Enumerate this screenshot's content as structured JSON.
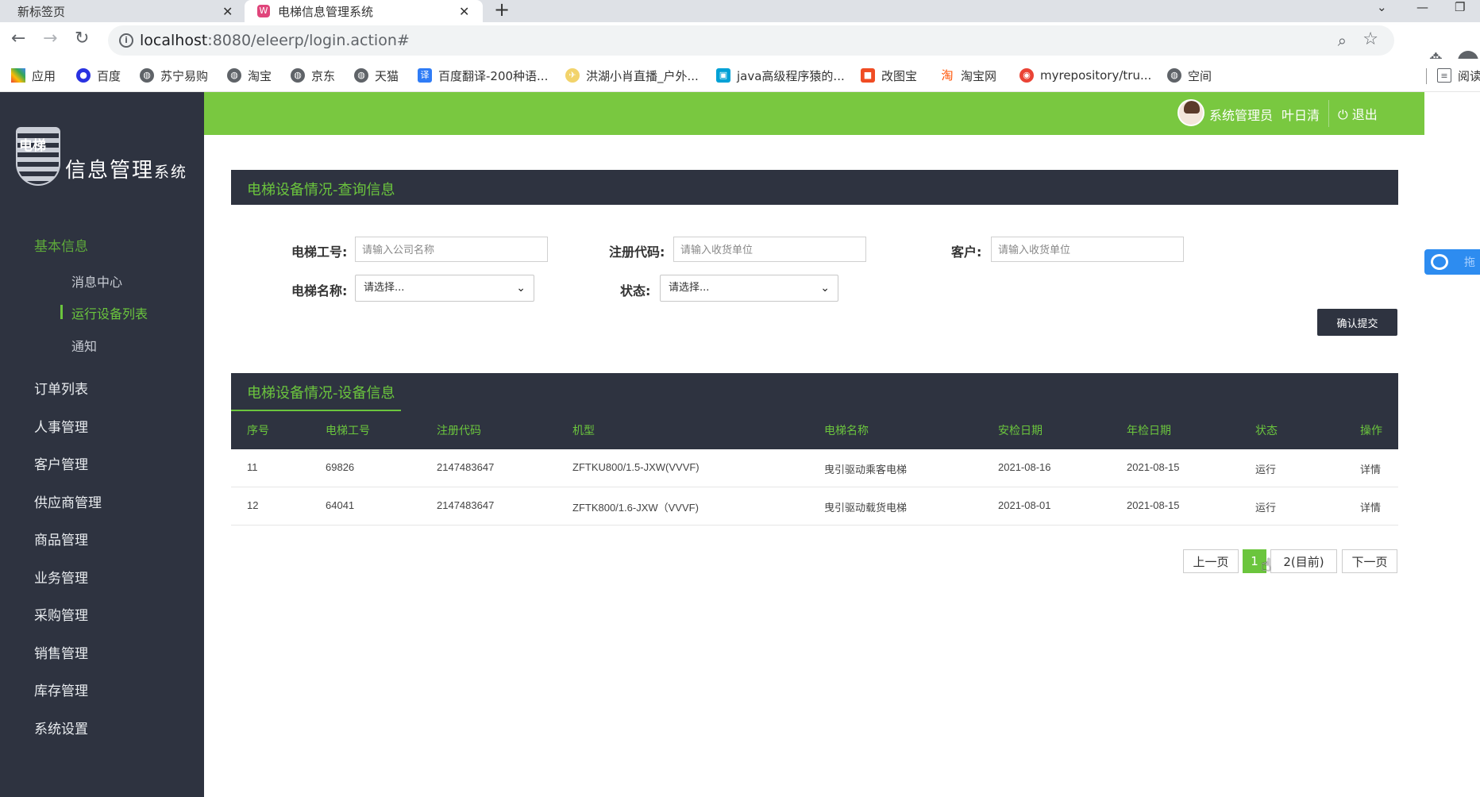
{
  "browser": {
    "tabs": [
      {
        "title": "新标签页",
        "active": false
      },
      {
        "title": "电梯信息管理系统",
        "active": true
      }
    ],
    "url_host": "localhost",
    "url_path": ":8080/eleerp/login.action#",
    "bookmarks": [
      "应用",
      "百度",
      "苏宁易购",
      "淘宝",
      "京东",
      "天猫",
      "百度翻译-200种语...",
      "洪湖小肖直播_户外...",
      "java高级程序猿的...",
      "改图宝",
      "淘宝网",
      "myrepository/tru...",
      "空间"
    ],
    "reading_list": "阅读"
  },
  "logo": {
    "shield_text": "电梯",
    "title": "信息管理",
    "title_small": "系统"
  },
  "sidebar": {
    "groups": [
      {
        "label": "基本信息",
        "active": true
      },
      {
        "label": "订单列表"
      },
      {
        "label": "人事管理"
      },
      {
        "label": "客户管理"
      },
      {
        "label": "供应商管理"
      },
      {
        "label": "商品管理"
      },
      {
        "label": "业务管理"
      },
      {
        "label": "采购管理"
      },
      {
        "label": "销售管理"
      },
      {
        "label": "库存管理"
      },
      {
        "label": "系统设置"
      }
    ],
    "sub_items": [
      {
        "label": "消息中心"
      },
      {
        "label": "运行设备列表",
        "active": true
      },
      {
        "label": "通知"
      }
    ]
  },
  "topbar": {
    "role": "系统管理员",
    "user": "叶日清",
    "logout": "退出"
  },
  "query_panel": {
    "title": "电梯设备情况-查询信息",
    "fields": {
      "elevator_no": {
        "label": "电梯工号:",
        "placeholder": "请输入公司名称"
      },
      "reg_code": {
        "label": "注册代码:",
        "placeholder": "请输入收货单位"
      },
      "customer": {
        "label": "客户:",
        "placeholder": "请输入收货单位"
      },
      "elevator_name": {
        "label": "电梯名称:",
        "selected": "请选择..."
      },
      "status": {
        "label": "状态:",
        "selected": "请选择..."
      }
    },
    "submit": "确认提交"
  },
  "table_panel": {
    "title": "电梯设备情况-设备信息",
    "columns": [
      "序号",
      "电梯工号",
      "注册代码",
      "机型",
      "电梯名称",
      "安检日期",
      "年检日期",
      "状态",
      "操作"
    ],
    "rows": [
      [
        "11",
        "69826",
        "2147483647",
        "ZFTKU800/1.5-JXW(VVVF)",
        "曳引驱动乘客电梯",
        "2021-08-16",
        "2021-08-15",
        "运行",
        "详情"
      ],
      [
        "12",
        "64041",
        "2147483647",
        "ZFTK800/1.6-JXW（VVVF)",
        "曳引驱动载货电梯",
        "2021-08-01",
        "2021-08-15",
        "运行",
        "详情"
      ]
    ]
  },
  "pagination": {
    "prev": "上一页",
    "page1": "1",
    "page2": "2(目前)",
    "next": "下一页"
  },
  "float_widget": {
    "text": "拖"
  },
  "colors": {
    "accent_green": "#6bc53d",
    "topbar_green": "#79c840",
    "dark_navy": "#2e3340"
  }
}
